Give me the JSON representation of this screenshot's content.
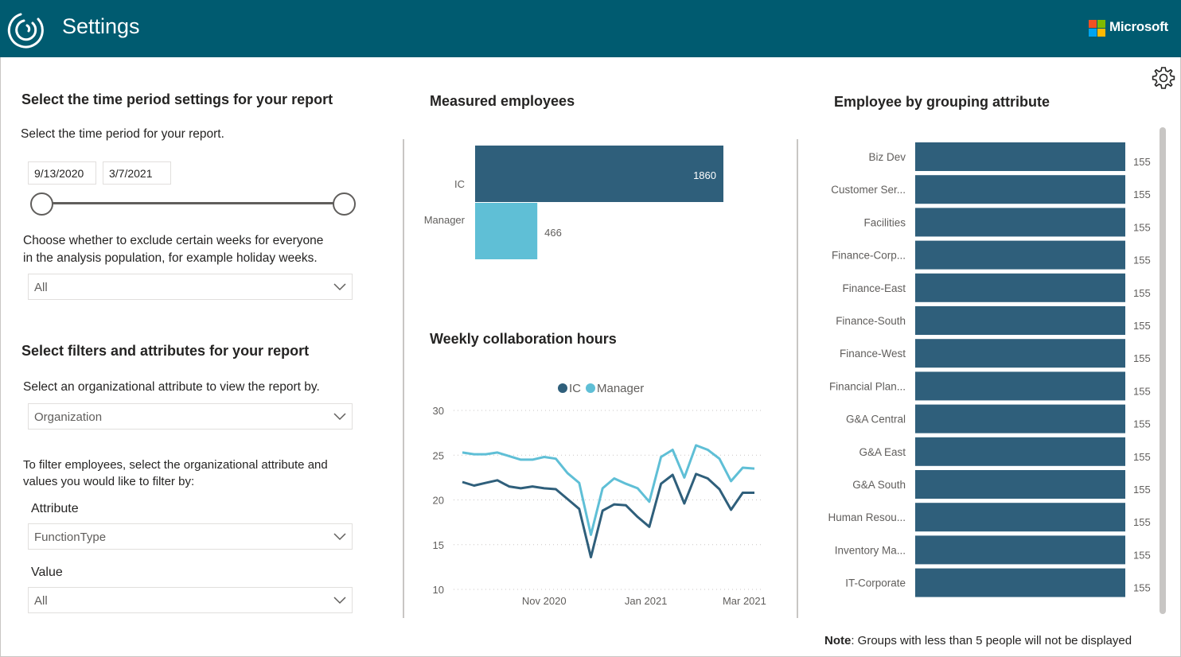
{
  "header": {
    "title": "Settings",
    "brand": "Microsoft"
  },
  "icons": {
    "logo": "viva-insights-logo-icon",
    "microsoft": "microsoft-logo-icon",
    "settings": "gear-icon",
    "dropdown": "chevron-down-icon"
  },
  "colors": {
    "header_bg": "#005b70",
    "ic": "#2f5f7b",
    "manager": "#5fbfd6"
  },
  "time_section": {
    "heading": "Select the time period settings for your report",
    "instruction": "Select the time period for your report.",
    "start_date": "9/13/2020",
    "end_date": "3/7/2021",
    "exclude_text_1": "Choose whether to exclude certain weeks for everyone",
    "exclude_text_2": "in the analysis population, for example holiday weeks.",
    "exclude_value": "All"
  },
  "filter_section": {
    "heading": "Select filters and attributes for your report",
    "org_instruction": "Select an organizational attribute to view the report by.",
    "org_value": "Organization",
    "filter_text_1": "To filter employees, select the organizational attribute and",
    "filter_text_2": "values you would like to filter by:",
    "attribute_label": "Attribute",
    "attribute_value": "FunctionType",
    "value_label": "Value",
    "value_value": "All"
  },
  "note": {
    "prefix": "Note",
    "text": ": Groups with less than 5 people will not be displayed"
  },
  "chart_data": [
    {
      "type": "bar",
      "title": "Measured employees",
      "orientation": "horizontal",
      "categories": [
        "IC",
        "Manager"
      ],
      "values": [
        1860,
        466
      ],
      "value_labels": [
        "1860",
        "466"
      ],
      "colors": [
        "#2f5f7b",
        "#5fbfd6"
      ]
    },
    {
      "type": "line",
      "title": "Weekly collaboration hours",
      "legend": [
        "IC",
        "Manager"
      ],
      "legend_position": "top",
      "ylim": [
        10,
        30
      ],
      "yticks": [
        "30",
        "25",
        "20",
        "15",
        "10"
      ],
      "xticks": [
        "Nov 2020",
        "Jan 2021",
        "Mar 2021"
      ],
      "grid": true,
      "x": [
        "2020-09-13",
        "2020-09-20",
        "2020-09-27",
        "2020-10-04",
        "2020-10-11",
        "2020-10-18",
        "2020-10-25",
        "2020-11-01",
        "2020-11-08",
        "2020-11-15",
        "2020-11-22",
        "2020-11-29",
        "2020-12-06",
        "2020-12-13",
        "2020-12-20",
        "2020-12-27",
        "2021-01-03",
        "2021-01-10",
        "2021-01-17",
        "2021-01-24",
        "2021-01-31",
        "2021-02-07",
        "2021-02-14",
        "2021-02-21",
        "2021-02-28",
        "2021-03-07"
      ],
      "series": [
        {
          "name": "IC",
          "color": "#2f5f7b",
          "values": [
            22.0,
            21.6,
            21.9,
            22.2,
            21.5,
            21.3,
            21.5,
            21.3,
            21.2,
            20.1,
            19.0,
            13.6,
            18.8,
            19.5,
            19.4,
            18.1,
            17.0,
            21.8,
            22.8,
            19.6,
            22.9,
            22.4,
            21.2,
            18.9,
            20.8,
            20.8
          ]
        },
        {
          "name": "Manager",
          "color": "#5fbfd6",
          "values": [
            25.3,
            25.1,
            25.1,
            25.3,
            24.9,
            24.5,
            24.5,
            24.8,
            24.6,
            23.0,
            21.9,
            16.1,
            21.3,
            22.4,
            21.8,
            21.3,
            19.8,
            24.8,
            25.6,
            22.5,
            26.1,
            25.6,
            24.6,
            22.1,
            23.6,
            23.5
          ]
        }
      ]
    },
    {
      "type": "bar",
      "title": "Employee by grouping attribute",
      "orientation": "horizontal",
      "categories": [
        "Biz Dev",
        "Customer Ser...",
        "Facilities",
        "Finance-Corp...",
        "Finance-East",
        "Finance-South",
        "Finance-West",
        "Financial Plan...",
        "G&A Central",
        "G&A East",
        "G&A South",
        "Human Resou...",
        "Inventory Ma...",
        "IT-Corporate"
      ],
      "values": [
        155,
        155,
        155,
        155,
        155,
        155,
        155,
        155,
        155,
        155,
        155,
        155,
        155,
        155
      ],
      "color": "#2f5f7b"
    }
  ]
}
